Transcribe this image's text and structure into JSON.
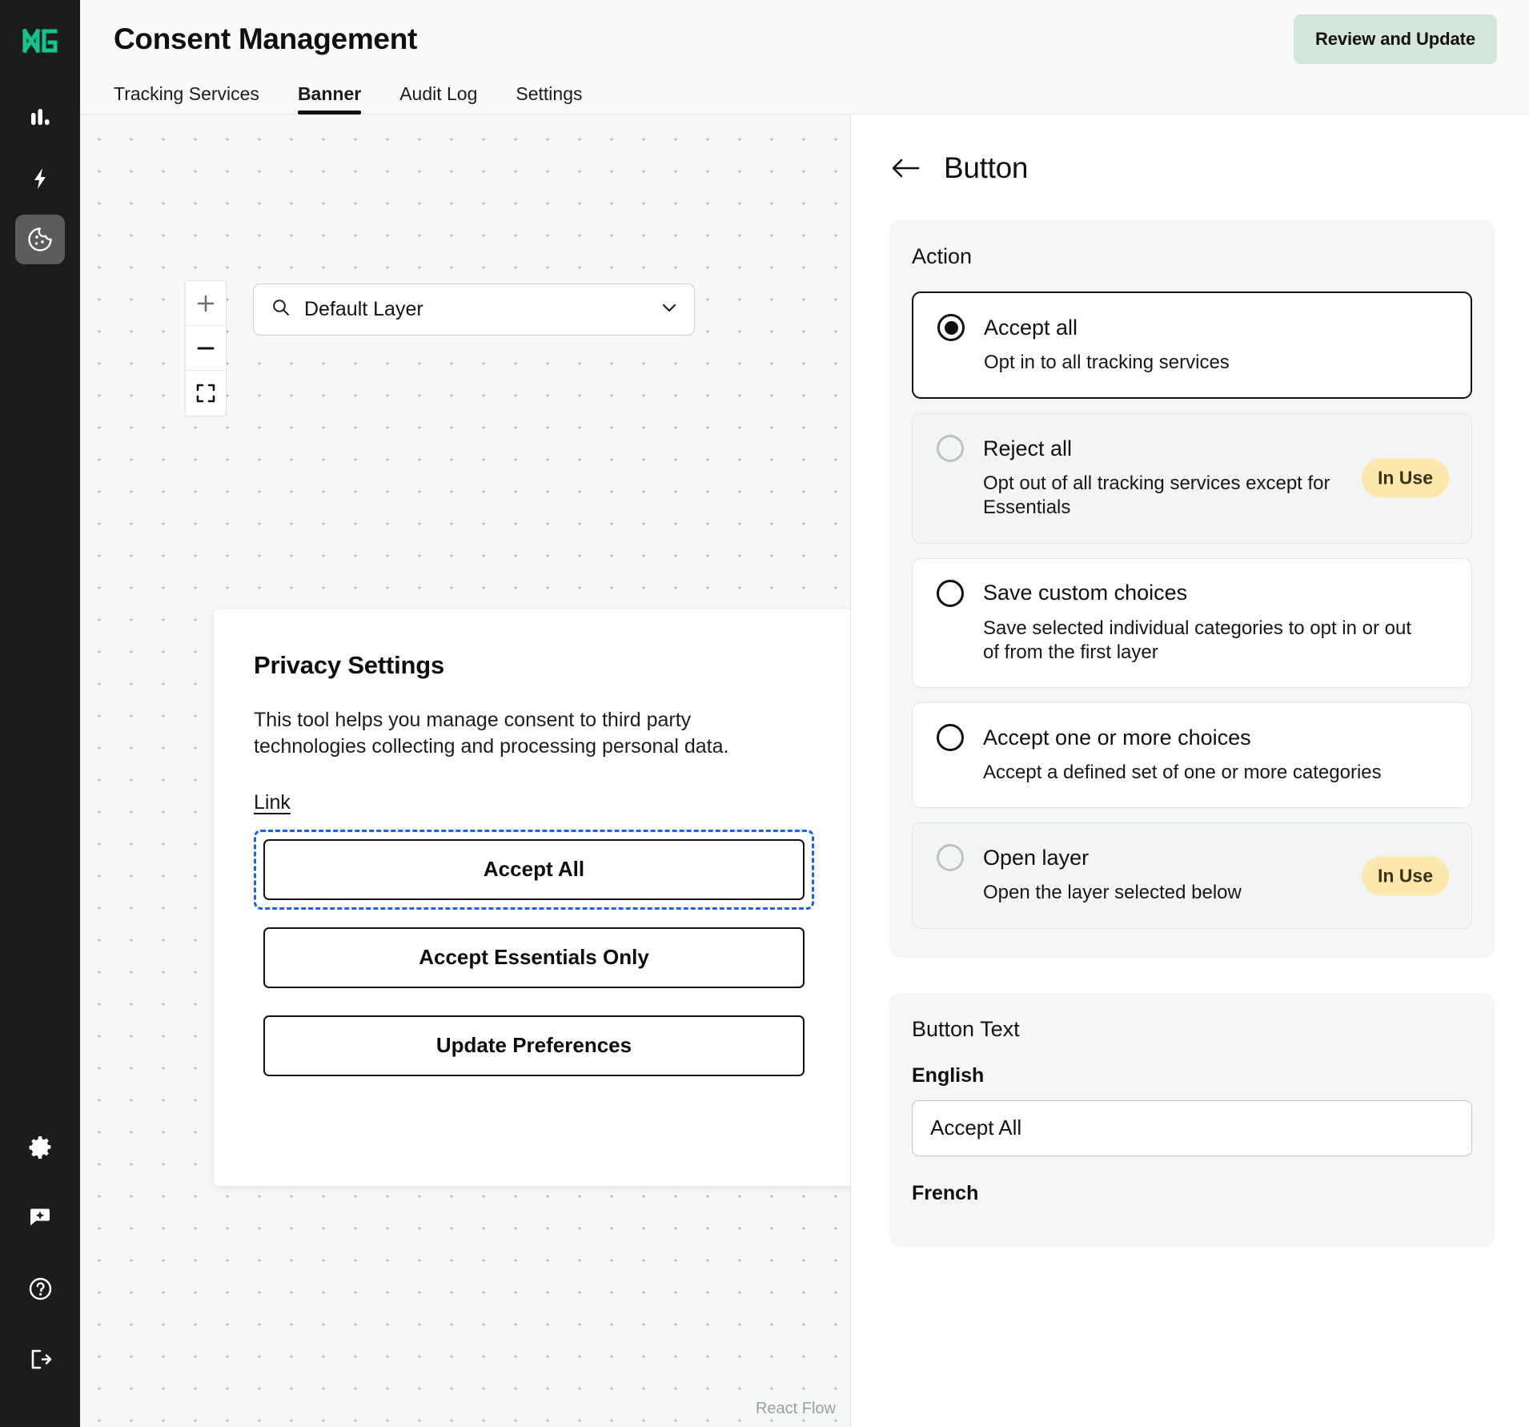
{
  "rail": {
    "logo_icon": "dna-logo-icon",
    "top_items": [
      {
        "icon": "bar-chart-icon",
        "name": "analytics",
        "active": false
      },
      {
        "icon": "lightning-bolt-icon",
        "name": "automation",
        "active": false
      },
      {
        "icon": "cookie-icon",
        "name": "consent",
        "active": true
      }
    ],
    "bottom_items": [
      {
        "icon": "gear-icon",
        "name": "settings"
      },
      {
        "icon": "chat-sparkle-icon",
        "name": "assistant"
      },
      {
        "icon": "help-circle-icon",
        "name": "help"
      },
      {
        "icon": "logout-icon",
        "name": "logout"
      }
    ]
  },
  "header": {
    "title": "Consent Management",
    "review_button": "Review and Update"
  },
  "tabs": [
    {
      "label": "Tracking Services",
      "active": false
    },
    {
      "label": "Banner",
      "active": true
    },
    {
      "label": "Audit Log",
      "active": false
    },
    {
      "label": "Settings",
      "active": false
    }
  ],
  "canvas": {
    "zoom_in_label": "+",
    "zoom_out_label": "—",
    "fit_view_icon": "fit-view-icon",
    "layer_select": {
      "icon": "search-icon",
      "value": "Default Layer",
      "chevron_icon": "chevron-down-icon"
    },
    "banner": {
      "title": "Privacy Settings",
      "body": "This tool helps you manage consent to third party technologies collecting and processing personal data.",
      "link": "Link",
      "buttons": [
        {
          "label": "Accept All",
          "selected": true
        },
        {
          "label": "Accept Essentials Only",
          "selected": false
        },
        {
          "label": "Update Preferences",
          "selected": false
        }
      ]
    },
    "watermark": "React Flow"
  },
  "panel": {
    "back_icon": "arrow-left-icon",
    "title": "Button",
    "action": {
      "title": "Action",
      "options": [
        {
          "label": "Accept all",
          "desc": "Opt in to all tracking services",
          "selected": true,
          "muted": false,
          "badge": null
        },
        {
          "label": "Reject all",
          "desc": "Opt out of all tracking services except for Essentials",
          "selected": false,
          "muted": true,
          "badge": "In Use"
        },
        {
          "label": "Save custom choices",
          "desc": "Save selected individual categories to opt in or out of from the first layer",
          "selected": false,
          "muted": false,
          "badge": null
        },
        {
          "label": "Accept one or more choices",
          "desc": "Accept a defined set of one or more categories",
          "selected": false,
          "muted": false,
          "badge": null
        },
        {
          "label": "Open layer",
          "desc": "Open the layer selected below",
          "selected": false,
          "muted": true,
          "badge": "In Use"
        }
      ]
    },
    "button_text": {
      "title": "Button Text",
      "fields": [
        {
          "language": "English",
          "value": "Accept All"
        },
        {
          "language": "French",
          "value": ""
        }
      ]
    }
  },
  "colors": {
    "rail_bg": "#1c1c1c",
    "logo_green": "#14c38e",
    "accent_mint": "#d5e6dd",
    "badge_bg": "#fce7ad",
    "selection_blue": "#1a62e8",
    "canvas_bg": "#f6f8f7"
  }
}
